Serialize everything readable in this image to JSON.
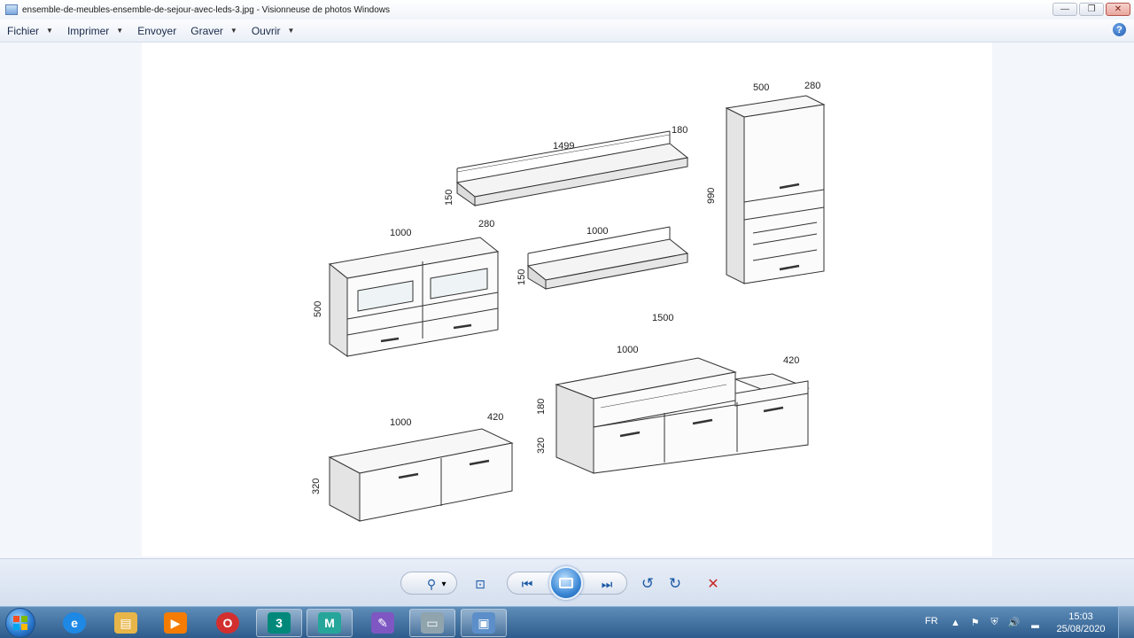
{
  "window": {
    "title": "ensemble-de-meubles-ensemble-de-sejour-avec-leds-3.jpg - Visionneuse de photos Windows",
    "min_glyph": "—",
    "max_glyph": "❐",
    "close_glyph": "✕"
  },
  "menu": {
    "items": [
      {
        "label": "Fichier",
        "arrow": "▼"
      },
      {
        "label": "Imprimer",
        "arrow": "▼"
      },
      {
        "label": "Envoyer",
        "arrow": ""
      },
      {
        "label": "Graver",
        "arrow": "▼"
      },
      {
        "label": "Ouvrir",
        "arrow": "▼"
      }
    ],
    "help_glyph": "?"
  },
  "drawing": {
    "shelf_top": {
      "width": "1499",
      "depth": "180",
      "height": "150"
    },
    "shelf_mid": {
      "width": "1000",
      "height": "150"
    },
    "cabinet": {
      "width": "1000",
      "depth": "280",
      "height": "500"
    },
    "tall_cabinet": {
      "width": "500",
      "depth": "280",
      "height": "990"
    },
    "tv_unit_small": {
      "width": "1000",
      "depth": "420",
      "height": "320"
    },
    "tv_unit_large": {
      "width": "1500",
      "inner_width": "1000",
      "depth": "420",
      "upper_height": "180",
      "lower_height": "320"
    }
  },
  "controls": {
    "zoom_glyph": "⚲",
    "zoom_arrow": "▾",
    "fit_glyph": "⊡",
    "prev_glyph": "⏮",
    "next_glyph": "⏭",
    "rotate_ccw_glyph": "↺",
    "rotate_cw_glyph": "↻",
    "delete_glyph": "✕",
    "colors": {
      "accent": "#1c5aa5",
      "delete": "#c62828"
    }
  },
  "taskbar": {
    "apps": [
      {
        "name": "internet-explorer",
        "glyph": "e",
        "color": "#1e88e5"
      },
      {
        "name": "file-explorer",
        "glyph": "▤",
        "color": "#e8b548"
      },
      {
        "name": "media-player",
        "glyph": "▶",
        "color": "#f57c00"
      },
      {
        "name": "opera",
        "glyph": "O",
        "color": "#d32f2f"
      },
      {
        "name": "autodesk-3dsmax",
        "glyph": "3",
        "color": "#00897b"
      },
      {
        "name": "autodesk-maya",
        "glyph": "M",
        "color": "#26a69a"
      },
      {
        "name": "paint",
        "glyph": "✎",
        "color": "#7e57c2"
      },
      {
        "name": "video-app",
        "glyph": "▭",
        "color": "#90a4ae"
      },
      {
        "name": "photo-viewer",
        "glyph": "▣",
        "color": "#5c8fc9"
      }
    ],
    "language": "FR",
    "tray_glyphs": [
      "▲",
      "⚑",
      "⛨",
      "🔊",
      "▂"
    ],
    "time": "15:03",
    "date": "25/08/2020"
  }
}
